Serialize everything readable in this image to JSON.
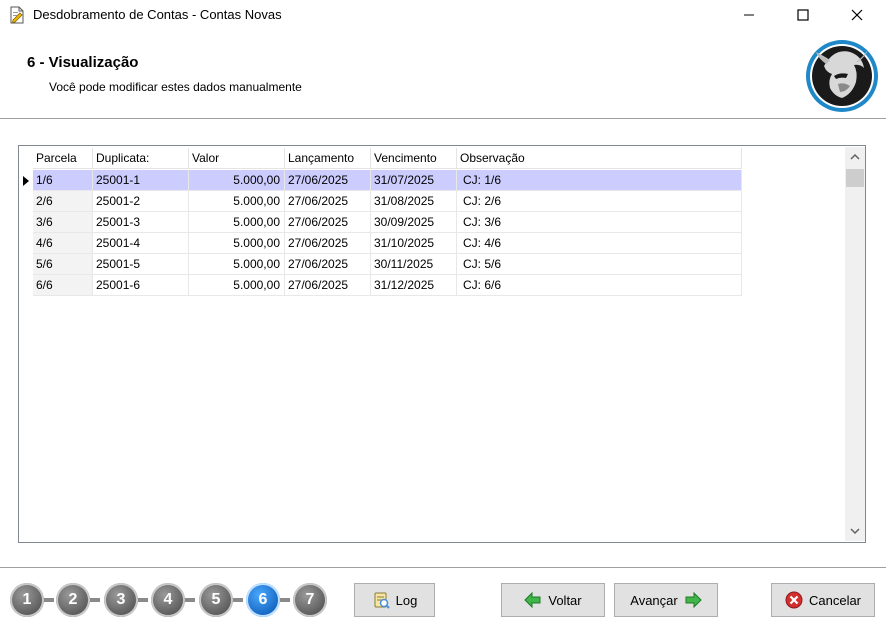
{
  "window": {
    "title": "Desdobramento de Contas - Contas Novas",
    "icons": {
      "app": "document-edit-icon",
      "minimize": "minimize-icon",
      "maximize": "maximize-icon",
      "close": "close-icon"
    }
  },
  "header": {
    "step_title": "6 - Visualização",
    "subtitle": "Você pode modificar estes dados manualmente",
    "logo_icon": "warrior-head-logo"
  },
  "grid": {
    "columns": [
      "Parcela",
      "Duplicata:",
      "Valor",
      "Lançamento",
      "Vencimento",
      "Observação"
    ],
    "rows": [
      {
        "parcela": "1/6",
        "duplicata": "25001-1",
        "valor": "5.000,00",
        "lancamento": "27/06/2025",
        "vencimento": "31/07/2025",
        "observacao": "CJ: 1/6"
      },
      {
        "parcela": "2/6",
        "duplicata": "25001-2",
        "valor": "5.000,00",
        "lancamento": "27/06/2025",
        "vencimento": "31/08/2025",
        "observacao": "CJ: 2/6"
      },
      {
        "parcela": "3/6",
        "duplicata": "25001-3",
        "valor": "5.000,00",
        "lancamento": "27/06/2025",
        "vencimento": "30/09/2025",
        "observacao": "CJ: 3/6"
      },
      {
        "parcela": "4/6",
        "duplicata": "25001-4",
        "valor": "5.000,00",
        "lancamento": "27/06/2025",
        "vencimento": "31/10/2025",
        "observacao": "CJ: 4/6"
      },
      {
        "parcela": "5/6",
        "duplicata": "25001-5",
        "valor": "5.000,00",
        "lancamento": "27/06/2025",
        "vencimento": "30/11/2025",
        "observacao": "CJ: 5/6"
      },
      {
        "parcela": "6/6",
        "duplicata": "25001-6",
        "valor": "5.000,00",
        "lancamento": "27/06/2025",
        "vencimento": "31/12/2025",
        "observacao": "CJ: 6/6"
      }
    ],
    "selected_row": 0,
    "selection_color": "#ccccff"
  },
  "wizard": {
    "steps": [
      "1",
      "2",
      "3",
      "4",
      "5",
      "6",
      "7"
    ],
    "current_step": "6",
    "active_color": "#1565c0"
  },
  "buttons": {
    "log": "Log",
    "voltar": "Voltar",
    "avancar": "Avançar",
    "cancelar": "Cancelar",
    "icons": {
      "log": "log-icon",
      "voltar": "arrow-left-icon",
      "avancar": "arrow-right-icon",
      "cancelar": "cancel-icon"
    }
  }
}
